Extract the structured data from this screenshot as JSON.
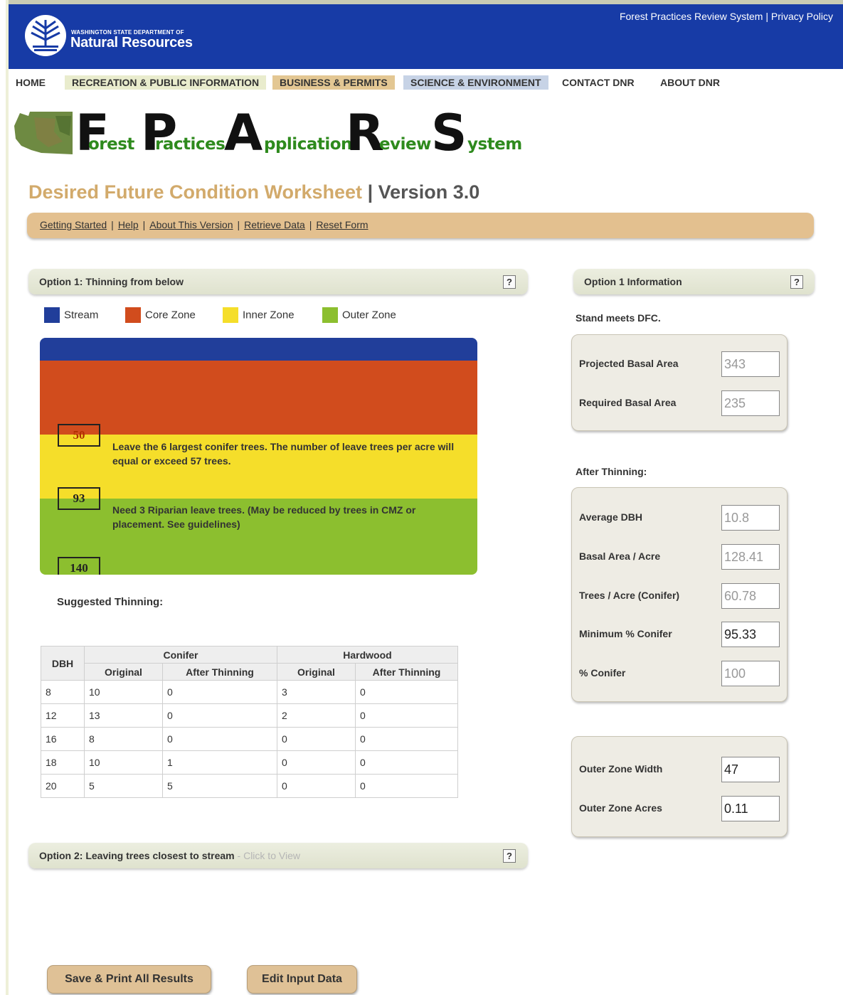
{
  "header": {
    "dept_small": "WASHINGTON STATE DEPARTMENT OF",
    "dept_big": "Natural Resources",
    "links": [
      "Forest Practices Review System",
      "Privacy Policy"
    ]
  },
  "nav": {
    "items": [
      "HOME",
      "RECREATION & PUBLIC INFORMATION",
      "BUSINESS & PERMITS",
      "SCIENCE & ENVIRONMENT",
      "CONTACT DNR",
      "ABOUT DNR"
    ]
  },
  "banner": {
    "words": [
      {
        "big": "F",
        "rest": "orest"
      },
      {
        "big": "P",
        "rest": "ractices"
      },
      {
        "big": "A",
        "rest": "pplication"
      },
      {
        "big": "R",
        "rest": "eview"
      },
      {
        "big": "S",
        "rest": "ystem"
      }
    ]
  },
  "worksheet": {
    "title": "Desired Future Condition Worksheet",
    "separator": "|",
    "version": "Version 3.0"
  },
  "subnav": {
    "links": [
      "Getting Started",
      "Help",
      "About This Version",
      "Retrieve Data",
      "Reset Form"
    ],
    "separator": "|"
  },
  "option1": {
    "title": "Option 1: Thinning from below",
    "help": "?"
  },
  "legend": [
    {
      "label": "Stream",
      "color": "#213e9a"
    },
    {
      "label": "Core Zone",
      "color": "#d14c1d"
    },
    {
      "label": "Inner Zone",
      "color": "#f5de2a"
    },
    {
      "label": "Outer Zone",
      "color": "#8cbf2f"
    }
  ],
  "zones": {
    "colors": {
      "stream": "#213e9a",
      "core": "#d14c1d",
      "inner": "#f5de2a",
      "outer": "#8cbf2f"
    },
    "core_width": "50",
    "inner_width": "93",
    "outer_width": "140",
    "inner_text": "Leave the 6 largest conifer trees. The number of leave trees per acre will equal or exceed 57 trees.",
    "outer_text": "Need 3 Riparian leave trees. (May be reduced by trees in CMZ or placement. See guidelines)"
  },
  "suggested_label": "Suggested Thinning:",
  "table": {
    "dbh_header": "DBH",
    "group_headers": [
      "Conifer",
      "Hardwood"
    ],
    "sub_headers": [
      "Original",
      "After Thinning",
      "Original",
      "After Thinning"
    ],
    "rows": [
      [
        "8",
        "10",
        "0",
        "3",
        "0"
      ],
      [
        "12",
        "13",
        "0",
        "2",
        "0"
      ],
      [
        "16",
        "8",
        "0",
        "0",
        "0"
      ],
      [
        "18",
        "10",
        "1",
        "0",
        "0"
      ],
      [
        "20",
        "5",
        "5",
        "0",
        "0"
      ]
    ]
  },
  "option2": {
    "title": "Option 2: Leaving trees closest to stream",
    "hint": " - Click to View",
    "help": "?"
  },
  "info": {
    "title": "Option 1 Information",
    "help": "?",
    "status": "Stand meets DFC.",
    "basal": [
      {
        "label": "Projected Basal Area",
        "value": "343"
      },
      {
        "label": "Required Basal Area",
        "value": "235"
      }
    ],
    "after_label": "After Thinning:",
    "after": [
      {
        "label": "Average DBH",
        "value": "10.8",
        "ro": true
      },
      {
        "label": "Basal Area / Acre",
        "value": "128.41",
        "ro": true
      },
      {
        "label": "Trees / Acre (Conifer)",
        "value": "60.78",
        "ro": true
      },
      {
        "label": "Minimum % Conifer",
        "value": "95.33",
        "ro": false
      },
      {
        "label": "% Conifer",
        "value": "100",
        "ro": true
      }
    ],
    "outer": [
      {
        "label": "Outer Zone Width",
        "value": "47"
      },
      {
        "label": "Outer Zone Acres",
        "value": "0.11"
      }
    ]
  },
  "buttons": {
    "save": "Save & Print All Results",
    "edit": "Edit Input Data"
  }
}
